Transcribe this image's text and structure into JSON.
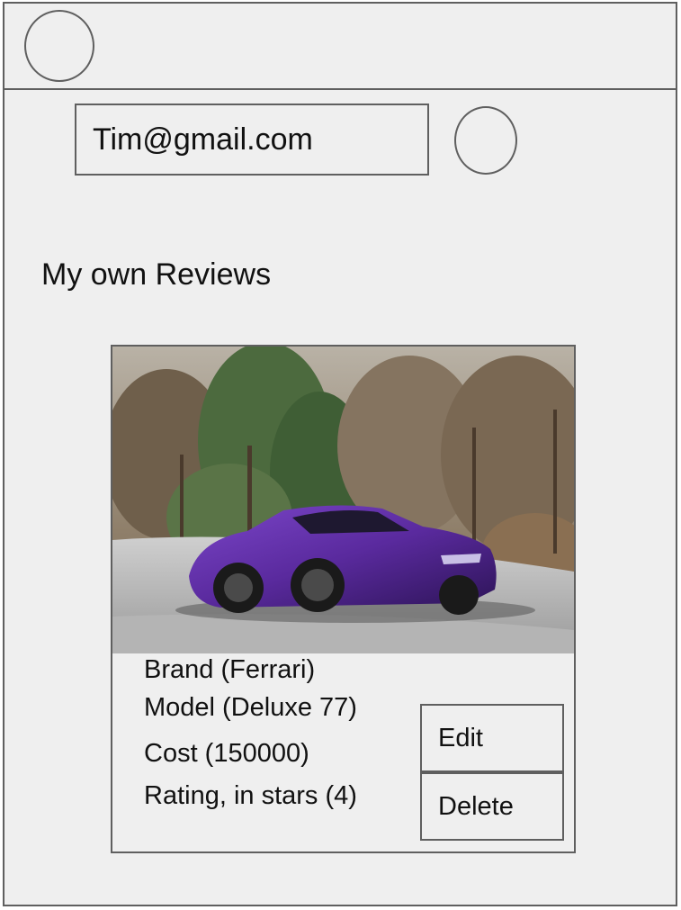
{
  "user": {
    "email": "Tim@gmail.com"
  },
  "page": {
    "title": "My own Reviews"
  },
  "review": {
    "photo_alt": "purple sports car",
    "brand": "Brand (Ferrari)",
    "model": "Model (Deluxe 77)",
    "cost": "Cost (150000)",
    "rating": "Rating, in stars (4)",
    "car_color": "#5a2a9e"
  },
  "actions": {
    "edit_label": "Edit",
    "delete_label": "Delete"
  }
}
